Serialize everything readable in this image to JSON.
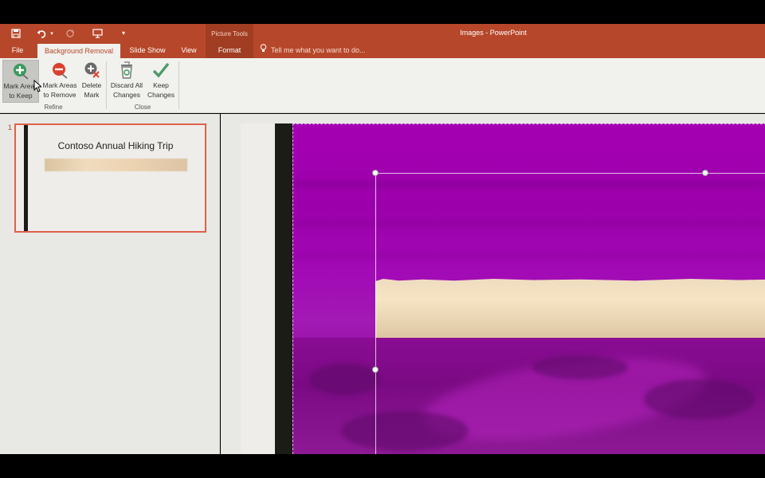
{
  "window": {
    "title": "Images - PowerPoint"
  },
  "quick_access": {
    "save_icon": "save-icon",
    "undo_icon": "undo-icon",
    "redo_icon": "redo-icon",
    "start_from_beginning_icon": "presentation-start-icon",
    "customize_icon": "dropdown-icon"
  },
  "context_group": {
    "label": "Picture Tools"
  },
  "tabs": [
    {
      "label": "File"
    },
    {
      "label": "Background Removal",
      "active": true
    },
    {
      "label": "Slide Show"
    },
    {
      "label": "View"
    },
    {
      "label": "Format"
    }
  ],
  "tell_me": {
    "placeholder": "Tell me what you want to do..."
  },
  "ribbon": {
    "refine": {
      "label": "Refine",
      "buttons": [
        {
          "line1": "Mark Areas",
          "line2": "to Keep",
          "icon": "plus-circle-icon",
          "pressed": true
        },
        {
          "line1": "Mark Areas",
          "line2": "to Remove",
          "icon": "minus-circle-icon"
        },
        {
          "line1": "Delete",
          "line2": "Mark",
          "icon": "delete-mark-icon"
        }
      ]
    },
    "close": {
      "label": "Close",
      "buttons": [
        {
          "line1": "Discard All",
          "line2": "Changes",
          "icon": "recycle-bin-icon"
        },
        {
          "line1": "Keep",
          "line2": "Changes",
          "icon": "checkmark-icon"
        }
      ]
    }
  },
  "thumbnails": [
    {
      "number": "1",
      "title": "Contoso Annual Hiking Trip"
    }
  ],
  "colors": {
    "accent": "#b7472a",
    "removal_overlay": "#a400b2",
    "kept_area": "#f2dfbf"
  }
}
